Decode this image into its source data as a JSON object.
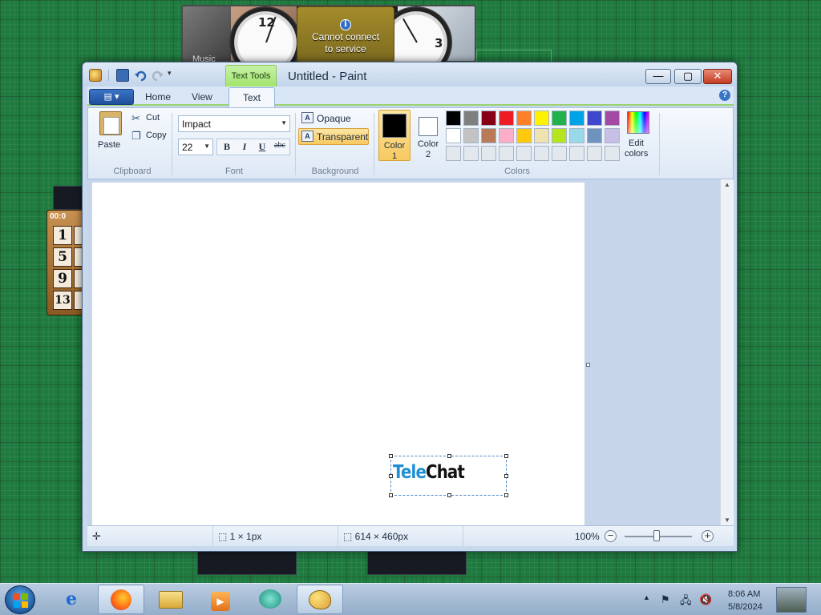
{
  "desktop": {
    "gadget_music_label": "Music",
    "weather_message_line1": "Cannot connect",
    "weather_message_line2": "to service",
    "clock_numerals": [
      "12",
      "3"
    ],
    "puzzle_timer": "00:0",
    "puzzle_numbers": [
      "1",
      "5",
      "9",
      "13"
    ]
  },
  "window": {
    "title": "Untitled - Paint",
    "contextual_tab": "Text Tools",
    "caption_buttons": {
      "minimize": "—",
      "maximize": "▢",
      "close": "✕"
    }
  },
  "menubar": {
    "file_button": "▤ ▾",
    "tabs": [
      "Home",
      "View"
    ],
    "active_tab": "Text",
    "help": "?"
  },
  "ribbon": {
    "clipboard": {
      "paste": "Paste",
      "cut": "Cut",
      "copy": "Copy",
      "label": "Clipboard"
    },
    "font": {
      "family": "Impact",
      "size": "22",
      "bold": "B",
      "italic": "I",
      "underline": "U",
      "strike": "abc",
      "label": "Font"
    },
    "background": {
      "opaque": "Opaque",
      "transparent": "Transparent",
      "label": "Background",
      "selected": "Transparent"
    },
    "colors": {
      "color1_line1": "Color",
      "color1_line2": "1",
      "color2_line1": "Color",
      "color2_line2": "2",
      "color1": "#000000",
      "color2": "#ffffff",
      "edit_line1": "Edit",
      "edit_line2": "colors",
      "label": "Colors",
      "palette_row1": [
        "#000000",
        "#7f7f7f",
        "#880015",
        "#ed1c24",
        "#ff7f27",
        "#fff200",
        "#22b14c",
        "#00a2e8",
        "#3f48cc",
        "#a349a4"
      ],
      "palette_row2": [
        "#ffffff",
        "#c3c3c3",
        "#b97a57",
        "#ffaec9",
        "#ffc90e",
        "#efe4b0",
        "#b5e61d",
        "#99d9ea",
        "#7092be",
        "#c8bfe7"
      ],
      "palette_row3": [
        "#e3e8ef",
        "#e3e8ef",
        "#e3e8ef",
        "#e3e8ef",
        "#e3e8ef",
        "#e3e8ef",
        "#e3e8ef",
        "#e3e8ef",
        "#e3e8ef",
        "#e3e8ef"
      ]
    }
  },
  "canvas": {
    "text_part1": "Tele",
    "text_part2": "Chat",
    "text_part1_color": "#1f8fd6",
    "text_part2_color": "#111111"
  },
  "statusbar": {
    "selection_size": "1 × 1px",
    "image_size": "614 × 460px",
    "zoom": "100%",
    "zoom_level": 1.0
  },
  "taskbar": {
    "apps": [
      "internet-explorer",
      "firefox",
      "file-explorer",
      "media-player",
      "messenger",
      "paint"
    ],
    "active_app": "paint",
    "time": "8:06 AM",
    "date": "5/8/2024"
  }
}
